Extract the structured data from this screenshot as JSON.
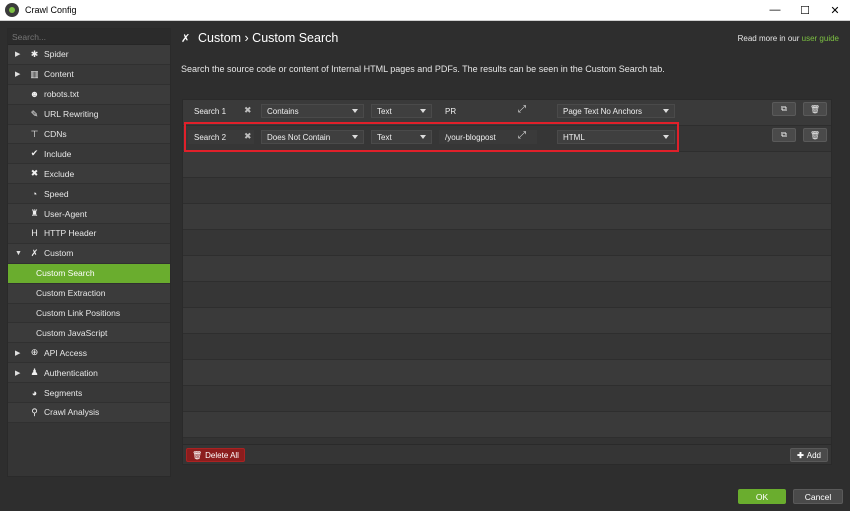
{
  "window": {
    "title": "Crawl Config",
    "minimize": "—",
    "maximize": "☐",
    "close": "✕"
  },
  "sidebar": {
    "search_placeholder": "Search...",
    "items": [
      {
        "label": "Spider",
        "arrow": "▶",
        "icon": "gear-icon",
        "glyph": "✱"
      },
      {
        "label": "Content",
        "arrow": "▶",
        "icon": "columns-icon",
        "glyph": "▥"
      },
      {
        "label": "robots.txt",
        "arrow": "",
        "icon": "robot-icon",
        "glyph": "☻"
      },
      {
        "label": "URL Rewriting",
        "arrow": "",
        "icon": "edit-icon",
        "glyph": "✎"
      },
      {
        "label": "CDNs",
        "arrow": "",
        "icon": "sitemap-icon",
        "glyph": "⊤"
      },
      {
        "label": "Include",
        "arrow": "",
        "icon": "check-circle-icon",
        "glyph": "✔"
      },
      {
        "label": "Exclude",
        "arrow": "",
        "icon": "x-circle-icon",
        "glyph": "✖"
      },
      {
        "label": "Speed",
        "arrow": "",
        "icon": "gauge-icon",
        "glyph": "◔"
      },
      {
        "label": "User-Agent",
        "arrow": "",
        "icon": "user-secret-icon",
        "glyph": "♜"
      },
      {
        "label": "HTTP Header",
        "arrow": "",
        "icon": "h-icon",
        "glyph": "H"
      },
      {
        "label": "Custom",
        "arrow": "▼",
        "icon": "tools-icon",
        "glyph": "✗"
      },
      {
        "label": "Custom Search",
        "sub": true,
        "active": true
      },
      {
        "label": "Custom Extraction",
        "sub": true
      },
      {
        "label": "Custom Link Positions",
        "sub": true
      },
      {
        "label": "Custom JavaScript",
        "sub": true
      },
      {
        "label": "API Access",
        "arrow": "▶",
        "icon": "globe-icon",
        "glyph": "⊕"
      },
      {
        "label": "Authentication",
        "arrow": "▶",
        "icon": "user-lock-icon",
        "glyph": "♟"
      },
      {
        "label": "Segments",
        "arrow": "",
        "icon": "pie-chart-icon",
        "glyph": "◕"
      },
      {
        "label": "Crawl Analysis",
        "arrow": "",
        "icon": "search-icon",
        "glyph": "⚲"
      }
    ]
  },
  "header": {
    "title": "Custom › Custom Search",
    "guide_prefix": "Read more in our ",
    "guide_link": "user guide"
  },
  "description": "Search the source code or content of Internal HTML pages and PDFs. The results can be seen in the Custom Search tab.",
  "searches": [
    {
      "name": "Search 1",
      "operator": "Contains",
      "type": "Text",
      "query": "PR",
      "scope": "Page Text No Anchors"
    },
    {
      "name": "Search 2",
      "operator": "Does Not Contain",
      "type": "Text",
      "query": "/your-blogpost",
      "scope": "HTML"
    }
  ],
  "buttons": {
    "delete_all": "Delete All",
    "add": "Add",
    "ok": "OK",
    "cancel": "Cancel"
  },
  "colors": {
    "accent_green": "#6aad2e",
    "link_green": "#7cc142",
    "highlight_red": "#e0202a",
    "delete_red": "#8b1d1d"
  }
}
